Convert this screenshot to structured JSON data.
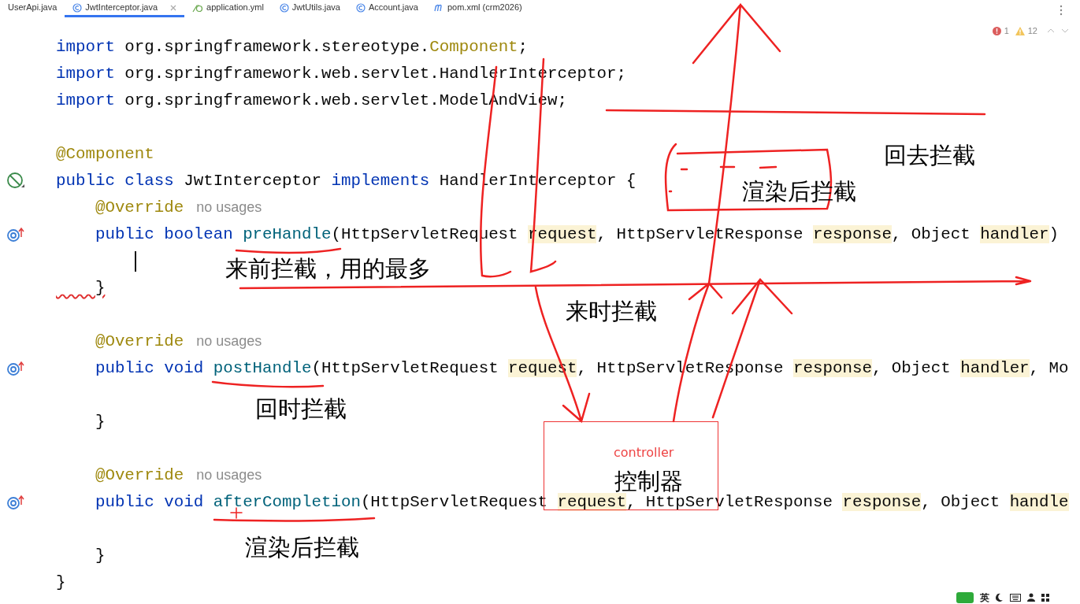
{
  "tabs": [
    {
      "label": "UserApi.java",
      "kind": "none",
      "selected": false,
      "closable": false
    },
    {
      "label": "JwtInterceptor.java",
      "kind": "class",
      "selected": true,
      "closable": true
    },
    {
      "label": "application.yml",
      "kind": "config",
      "selected": false,
      "closable": false
    },
    {
      "label": "JwtUtils.java",
      "kind": "class",
      "selected": false,
      "closable": false
    },
    {
      "label": "Account.java",
      "kind": "class",
      "selected": false,
      "closable": false
    },
    {
      "label": "pom.xml (crm2026)",
      "kind": "maven",
      "selected": false,
      "closable": false
    }
  ],
  "problems": {
    "errors": "1",
    "warnings": "12"
  },
  "code_lines": [
    {
      "caret": false,
      "tokens": [
        {
          "kind": "kw",
          "text": "import"
        },
        {
          "kind": "plain",
          "text": " org.springframework.stereotype."
        },
        {
          "kind": "ref",
          "text": "Component"
        },
        {
          "kind": "plain",
          "text": ";"
        }
      ]
    },
    {
      "caret": false,
      "tokens": [
        {
          "kind": "kw",
          "text": "import"
        },
        {
          "kind": "plain",
          "text": " org.springframework.web.servlet.HandlerInterceptor;"
        }
      ]
    },
    {
      "caret": false,
      "tokens": [
        {
          "kind": "kw",
          "text": "import"
        },
        {
          "kind": "plain",
          "text": " org.springframework.web.servlet.ModelAndView;"
        }
      ]
    },
    {
      "caret": false
    },
    {
      "caret": false,
      "tokens": [
        {
          "kind": "ref",
          "text": "@Component"
        }
      ]
    },
    {
      "caret": false,
      "gutter_icon": {
        "kind": "disabled"
      },
      "tokens": [
        {
          "kind": "kw",
          "text": "public class"
        },
        {
          "kind": "plain",
          "text": " JwtInterceptor "
        },
        {
          "kind": "kw",
          "text": "implements"
        },
        {
          "kind": "plain",
          "text": " HandlerInterceptor {"
        }
      ]
    },
    {
      "caret": false,
      "tokens": [
        {
          "kind": "ref",
          "text": "    @Override"
        },
        {
          "kind": "hint",
          "text": "no usages"
        }
      ]
    },
    {
      "caret": false,
      "gutter_icon": {
        "kind": "override"
      },
      "tokens": [
        {
          "kind": "kw",
          "text": "    public boolean "
        },
        {
          "kind": "method",
          "text": "preHandle"
        },
        {
          "kind": "plain",
          "text": "(HttpServletRequest "
        },
        {
          "kind": "param",
          "text": "request"
        },
        {
          "kind": "plain",
          "text": ", HttpServletResponse "
        },
        {
          "kind": "param",
          "text": "response"
        },
        {
          "kind": "plain",
          "text": ", Object "
        },
        {
          "kind": "param",
          "text": "handler"
        },
        {
          "kind": "plain",
          "text": ")"
        }
      ]
    },
    {
      "caret": true
    },
    {
      "caret": false,
      "tokens": [
        {
          "kind": "error",
          "text": "    }"
        }
      ]
    },
    {
      "caret": false
    },
    {
      "caret": false,
      "tokens": [
        {
          "kind": "ref",
          "text": "    @Override"
        },
        {
          "kind": "hint",
          "text": "no usages"
        }
      ]
    },
    {
      "caret": false,
      "gutter_icon": {
        "kind": "override"
      },
      "tokens": [
        {
          "kind": "kw",
          "text": "    public void "
        },
        {
          "kind": "method",
          "text": "postHandle"
        },
        {
          "kind": "plain",
          "text": "(HttpServletRequest "
        },
        {
          "kind": "param",
          "text": "request"
        },
        {
          "kind": "plain",
          "text": ", HttpServletResponse "
        },
        {
          "kind": "param",
          "text": "response"
        },
        {
          "kind": "plain",
          "text": ", Object "
        },
        {
          "kind": "param",
          "text": "handler"
        },
        {
          "kind": "plain",
          "text": ", Mo"
        }
      ]
    },
    {
      "caret": false
    },
    {
      "caret": false,
      "tokens": [
        {
          "kind": "plain",
          "text": "    }"
        }
      ]
    },
    {
      "caret": false
    },
    {
      "caret": false,
      "tokens": [
        {
          "kind": "ref",
          "text": "    @Override"
        },
        {
          "kind": "hint",
          "text": "no usages"
        }
      ]
    },
    {
      "caret": false,
      "gutter_icon": {
        "kind": "override"
      },
      "tokens": [
        {
          "kind": "kw",
          "text": "    public void "
        },
        {
          "kind": "method",
          "text": "afterCompletion"
        },
        {
          "kind": "plain",
          "text": "(HttpServletRequest "
        },
        {
          "kind": "param",
          "text": "request"
        },
        {
          "kind": "plain",
          "text": ", HttpServletResponse "
        },
        {
          "kind": "param",
          "text": "response"
        },
        {
          "kind": "plain",
          "text": ", Object "
        },
        {
          "kind": "param",
          "text": "handle"
        }
      ]
    },
    {
      "caret": false
    },
    {
      "caret": false,
      "tokens": [
        {
          "kind": "plain",
          "text": "    }"
        }
      ]
    },
    {
      "caret": false,
      "tokens": [
        {
          "kind": "plain",
          "text": "}"
        }
      ]
    }
  ],
  "annotations": [
    {
      "text": "回去拦截",
      "kind": "note"
    },
    {
      "text": "渲染后拦截",
      "kind": "note"
    },
    {
      "text": "来前拦截，用的最多",
      "kind": "note"
    },
    {
      "text": "来时拦截",
      "kind": "note"
    },
    {
      "text": "回时拦截",
      "kind": "note"
    },
    {
      "text": "controller",
      "kind": "label"
    },
    {
      "text": "控制器",
      "kind": "note"
    },
    {
      "text": "渲染后拦截",
      "kind": "note"
    }
  ],
  "ime": {
    "mode": "英"
  }
}
